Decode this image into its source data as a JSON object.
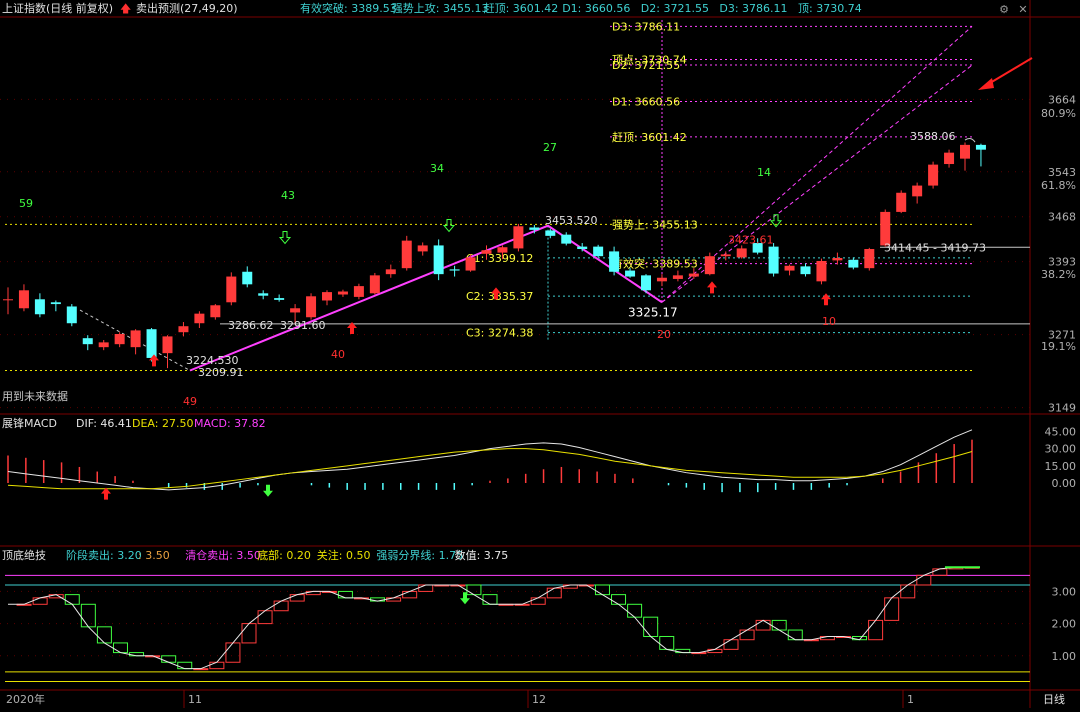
{
  "header": {
    "index_title": "上证指数(日线 前复权)",
    "indicator_name": "卖出预测(27,49,20)",
    "readings": [
      {
        "label": "有效突破: 3389.53",
        "color": "#3fd0d0"
      },
      {
        "label": "强势上攻: 3455.13",
        "color": "#3fd0d0"
      },
      {
        "label": "赶顶: 3601.42",
        "color": "#3fd0d0"
      },
      {
        "label": "D1: 3660.56",
        "color": "#3fd0d0"
      },
      {
        "label": "D2: 3721.55",
        "color": "#3fd0d0"
      },
      {
        "label": "D3: 3786.11",
        "color": "#3fd0d0"
      },
      {
        "label": "顶: 3730.74",
        "color": "#3fd0d0"
      }
    ],
    "future_data_note": "用到未来数据"
  },
  "price_axis": {
    "ticks": [
      {
        "value": 3664,
        "label": "3664"
      },
      {
        "value": 3543,
        "label": "3543"
      },
      {
        "value": 3468,
        "label": "3468"
      },
      {
        "value": 3393,
        "label": "3393"
      },
      {
        "value": 3271,
        "label": "3271"
      },
      {
        "value": 3149,
        "label": "3149"
      }
    ],
    "pct_ticks": [
      {
        "value": 3641,
        "label": "80.9%"
      },
      {
        "value": 3521,
        "label": "61.8%"
      },
      {
        "value": 3372,
        "label": "38.2%"
      },
      {
        "value": 3252,
        "label": "19.1%"
      }
    ]
  },
  "chart_data": [
    {
      "type": "candlestick",
      "ylim": [
        3140,
        3800
      ],
      "up_color": "#ff3b3b",
      "down_color": "#54ffff",
      "candles": [
        {
          "o": 3330,
          "h": 3350,
          "l": 3305,
          "c": 3330
        },
        {
          "o": 3315,
          "h": 3355,
          "l": 3310,
          "c": 3345
        },
        {
          "o": 3330,
          "h": 3340,
          "l": 3300,
          "c": 3305
        },
        {
          "o": 3325,
          "h": 3328,
          "l": 3310,
          "c": 3322
        },
        {
          "o": 3318,
          "h": 3322,
          "l": 3285,
          "c": 3290
        },
        {
          "o": 3265,
          "h": 3270,
          "l": 3245,
          "c": 3255
        },
        {
          "o": 3250,
          "h": 3262,
          "l": 3245,
          "c": 3258
        },
        {
          "o": 3255,
          "h": 3275,
          "l": 3250,
          "c": 3272
        },
        {
          "o": 3250,
          "h": 3280,
          "l": 3238,
          "c": 3278
        },
        {
          "o": 3280,
          "h": 3282,
          "l": 3226,
          "c": 3232
        },
        {
          "o": 3240,
          "h": 3270,
          "l": 3215,
          "c": 3268
        },
        {
          "o": 3275,
          "h": 3292,
          "l": 3268,
          "c": 3285
        },
        {
          "o": 3290,
          "h": 3310,
          "l": 3282,
          "c": 3306
        },
        {
          "o": 3300,
          "h": 3322,
          "l": 3296,
          "c": 3320
        },
        {
          "o": 3325,
          "h": 3375,
          "l": 3320,
          "c": 3368
        },
        {
          "o": 3376,
          "h": 3385,
          "l": 3350,
          "c": 3355
        },
        {
          "o": 3340,
          "h": 3345,
          "l": 3330,
          "c": 3336
        },
        {
          "o": 3332,
          "h": 3338,
          "l": 3326,
          "c": 3329
        },
        {
          "o": 3308,
          "h": 3322,
          "l": 3288,
          "c": 3315
        },
        {
          "o": 3300,
          "h": 3340,
          "l": 3296,
          "c": 3335
        },
        {
          "o": 3328,
          "h": 3345,
          "l": 3320,
          "c": 3342
        },
        {
          "o": 3338,
          "h": 3346,
          "l": 3334,
          "c": 3343
        },
        {
          "o": 3334,
          "h": 3356,
          "l": 3330,
          "c": 3352
        },
        {
          "o": 3340,
          "h": 3374,
          "l": 3338,
          "c": 3370
        },
        {
          "o": 3372,
          "h": 3388,
          "l": 3366,
          "c": 3380
        },
        {
          "o": 3382,
          "h": 3436,
          "l": 3378,
          "c": 3428
        },
        {
          "o": 3410,
          "h": 3425,
          "l": 3403,
          "c": 3420
        },
        {
          "o": 3420,
          "h": 3430,
          "l": 3362,
          "c": 3372
        },
        {
          "o": 3380,
          "h": 3386,
          "l": 3368,
          "c": 3378
        },
        {
          "o": 3378,
          "h": 3405,
          "l": 3376,
          "c": 3400
        },
        {
          "o": 3406,
          "h": 3420,
          "l": 3396,
          "c": 3412
        },
        {
          "o": 3408,
          "h": 3420,
          "l": 3397,
          "c": 3417
        },
        {
          "o": 3415,
          "h": 3456,
          "l": 3410,
          "c": 3452
        },
        {
          "o": 3450,
          "h": 3454,
          "l": 3440,
          "c": 3446
        },
        {
          "o": 3445,
          "h": 3448,
          "l": 3432,
          "c": 3436
        },
        {
          "o": 3438,
          "h": 3442,
          "l": 3420,
          "c": 3423
        },
        {
          "o": 3418,
          "h": 3424,
          "l": 3410,
          "c": 3414
        },
        {
          "o": 3418,
          "h": 3421,
          "l": 3400,
          "c": 3402
        },
        {
          "o": 3410,
          "h": 3418,
          "l": 3370,
          "c": 3376
        },
        {
          "o": 3378,
          "h": 3382,
          "l": 3366,
          "c": 3368
        },
        {
          "o": 3370,
          "h": 3372,
          "l": 3340,
          "c": 3345
        },
        {
          "o": 3360,
          "h": 3372,
          "l": 3352,
          "c": 3366
        },
        {
          "o": 3364,
          "h": 3378,
          "l": 3360,
          "c": 3370
        },
        {
          "o": 3368,
          "h": 3382,
          "l": 3364,
          "c": 3373
        },
        {
          "o": 3372,
          "h": 3408,
          "l": 3370,
          "c": 3402
        },
        {
          "o": 3402,
          "h": 3410,
          "l": 3395,
          "c": 3405
        },
        {
          "o": 3400,
          "h": 3420,
          "l": 3398,
          "c": 3415
        },
        {
          "o": 3424,
          "h": 3432,
          "l": 3405,
          "c": 3408
        },
        {
          "o": 3418,
          "h": 3424,
          "l": 3368,
          "c": 3373
        },
        {
          "o": 3378,
          "h": 3388,
          "l": 3370,
          "c": 3386
        },
        {
          "o": 3385,
          "h": 3390,
          "l": 3368,
          "c": 3372
        },
        {
          "o": 3360,
          "h": 3398,
          "l": 3355,
          "c": 3394
        },
        {
          "o": 3395,
          "h": 3408,
          "l": 3388,
          "c": 3399
        },
        {
          "o": 3396,
          "h": 3400,
          "l": 3380,
          "c": 3383
        },
        {
          "o": 3382,
          "h": 3416,
          "l": 3378,
          "c": 3414
        },
        {
          "o": 3420,
          "h": 3480,
          "l": 3418,
          "c": 3476
        },
        {
          "o": 3476,
          "h": 3512,
          "l": 3474,
          "c": 3508
        },
        {
          "o": 3502,
          "h": 3525,
          "l": 3490,
          "c": 3520
        },
        {
          "o": 3520,
          "h": 3560,
          "l": 3515,
          "c": 3555
        },
        {
          "o": 3556,
          "h": 3580,
          "l": 3550,
          "c": 3575
        },
        {
          "o": 3565,
          "h": 3592,
          "l": 3545,
          "c": 3588
        },
        {
          "o": 3588,
          "h": 3590,
          "l": 3552,
          "c": 3580
        }
      ],
      "price_annotations": [
        {
          "text": "3453.520",
          "value": 3453.52
        },
        {
          "text": "3325.17",
          "value": 3325.17
        },
        {
          "text": "3286.62",
          "value": 3286.62
        },
        {
          "text": "3291.60",
          "value": 3291.6
        },
        {
          "text": "3224.530",
          "value": 3224.53
        },
        {
          "text": "3209.91",
          "value": 3209.91
        },
        {
          "text": "3423.61",
          "value": 3423.61
        },
        {
          "text": "3588.06",
          "value": 3588.06
        },
        {
          "text": "3414.45 - 3419.73",
          "value": 3417
        }
      ],
      "levels": [
        {
          "label": "D3: 3786.11",
          "value": 3786.11,
          "color": "#ffff40"
        },
        {
          "label": "顶点: 3730.74",
          "value": 3730.74,
          "color": "#ffff40"
        },
        {
          "label": "D2: 3721.55",
          "value": 3721.55,
          "color": "#ffff40"
        },
        {
          "label": "D1: 3660.56",
          "value": 3660.56,
          "color": "#ffff40"
        },
        {
          "label": "赶顶: 3601.42",
          "value": 3601.42,
          "color": "#ffff40"
        },
        {
          "label": "强势上: 3455.13",
          "value": 3455.13,
          "color": "#ffff40"
        },
        {
          "label": "有效突: 3389.53",
          "value": 3389.53,
          "color": "#ffff40"
        },
        {
          "label": "C1: 3399.12",
          "value": 3399.12,
          "color": "#ffff40"
        },
        {
          "label": "C2: 3335.37",
          "value": 3335.37,
          "color": "#ffff40"
        },
        {
          "label": "C3: 3274.38",
          "value": 3274.38,
          "color": "#ffff40"
        }
      ],
      "cycle_counts": [
        "59",
        "43",
        "34",
        "27",
        "14",
        "40",
        "20",
        "49",
        "10"
      ]
    },
    {
      "type": "line",
      "title": "展锋MACD",
      "series": [
        {
          "name": "DIF",
          "label": "DIF: 46.41",
          "color": "#e6e6e6",
          "values": [
            10,
            8,
            6,
            4,
            2,
            0,
            -2,
            -4,
            -5,
            -6,
            -5,
            -4,
            -2,
            1,
            4,
            7,
            9,
            10,
            11,
            12,
            14,
            16,
            18,
            20,
            22,
            24,
            27,
            30,
            32,
            34,
            35,
            34,
            31,
            27,
            23,
            19,
            15,
            12,
            9,
            7,
            5,
            4,
            3,
            3,
            2,
            2,
            3,
            4,
            6,
            10,
            16,
            24,
            32,
            40,
            46.41
          ]
        },
        {
          "name": "DEA",
          "label": "DEA: 27.50",
          "color": "#e8e000",
          "values": [
            -2,
            -3,
            -4,
            -5,
            -5,
            -5,
            -5,
            -5,
            -5,
            -4,
            -3,
            -1,
            1,
            3,
            5,
            7,
            9,
            11,
            13,
            15,
            17,
            19,
            21,
            23,
            25,
            27,
            28,
            29,
            30,
            30,
            29,
            27,
            25,
            22,
            19,
            17,
            15,
            13,
            11,
            10,
            9,
            8,
            7,
            6,
            5,
            5,
            5,
            5,
            6,
            8,
            11,
            15,
            19,
            23,
            27.5
          ]
        }
      ],
      "macd": {
        "label": "MACD: 37.82",
        "value": 37.82
      },
      "ylim": [
        -55,
        55
      ],
      "yticks": [
        "45.00",
        "30.00",
        "15.00",
        "0.00"
      ]
    },
    {
      "type": "line",
      "title": "顶底绝技",
      "legend": [
        {
          "text": "阶段卖出: 3.20",
          "color": "#3fd0d0"
        },
        {
          "text": ": 3.50",
          "color": "#e8a040"
        },
        {
          "text": "清仓卖出: 3.50",
          "color": "#ff40ff"
        },
        {
          "text": "底部: 0.20",
          "color": "#e8e000"
        },
        {
          "text": "关注: 0.50",
          "color": "#e8e000"
        },
        {
          "text": "强弱分界线: 1.75",
          "color": "#3fd0d0"
        },
        {
          "text": "数值: 3.75",
          "color": "#e8e8e8"
        }
      ],
      "ylim": [
        0,
        4.1
      ],
      "yticks": [
        "3.00",
        "2.00",
        "1.00"
      ],
      "values": [
        2.6,
        2.6,
        2.8,
        2.9,
        2.6,
        1.9,
        1.4,
        1.1,
        1.0,
        1.0,
        0.8,
        0.6,
        0.6,
        0.8,
        1.4,
        2.0,
        2.4,
        2.7,
        2.9,
        3.0,
        3.0,
        2.8,
        2.8,
        2.7,
        2.8,
        3.0,
        3.2,
        3.2,
        3.2,
        2.9,
        2.6,
        2.6,
        2.6,
        2.8,
        3.1,
        3.2,
        3.2,
        2.9,
        2.6,
        2.2,
        1.6,
        1.2,
        1.1,
        1.1,
        1.2,
        1.5,
        1.8,
        2.1,
        1.8,
        1.5,
        1.5,
        1.6,
        1.6,
        1.5,
        2.1,
        2.8,
        3.2,
        3.5,
        3.7,
        3.75,
        3.75
      ]
    }
  ],
  "bottom_axis": {
    "year_label": "2020年",
    "month_labels": [
      "11",
      "12",
      "1"
    ],
    "period_label": "日线"
  }
}
